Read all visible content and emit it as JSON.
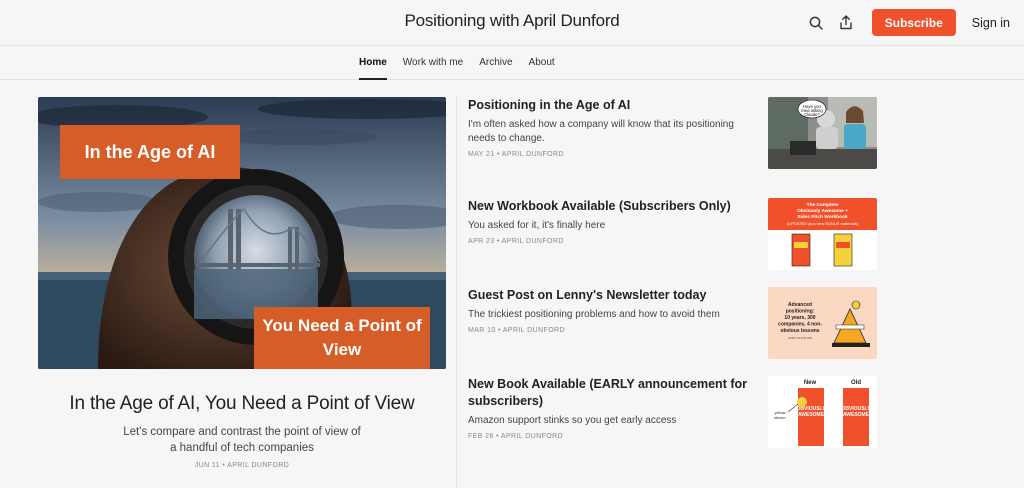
{
  "header": {
    "title": "Positioning with April Dunford",
    "subscribe_label": "Subscribe",
    "signin_label": "Sign in",
    "accent_color": "#f0512b"
  },
  "nav": {
    "tabs": [
      {
        "label": "Home",
        "active": true
      },
      {
        "label": "Work with me",
        "active": false
      },
      {
        "label": "Archive",
        "active": false
      },
      {
        "label": "About",
        "active": false
      }
    ]
  },
  "hero": {
    "image_text_top": "In the Age of AI",
    "image_text_bottom": "You Need a Point of View",
    "title": "In the Age of AI, You Need a Point of View",
    "subtitle": "Let's compare and contrast the point of view of a handful of tech companies",
    "meta": "JUN 11 • APRIL DUNFORD"
  },
  "posts": [
    {
      "title": "Positioning in the Age of AI",
      "subtitle": "I'm often asked how a company will know that its positioning needs to change.",
      "meta": "MAY 21 • APRIL DUNFORD",
      "thumb_text": "Have you tried asking Claude?"
    },
    {
      "title": "New Workbook Available (Subscribers Only)",
      "subtitle": "You asked for it, it's finally here",
      "meta": "APR 23 • APRIL DUNFORD",
      "thumb_text": "The Complete Obviously Awesome + Sales Pitch Workbook (UPDATED plus new BONUS materials)"
    },
    {
      "title": "Guest Post on Lenny's Newsletter today",
      "subtitle": "The trickiest positioning problems and how to avoid them",
      "meta": "MAR 10 • APRIL DUNFORD",
      "thumb_text": "Advanced positioning: 10 years, 300 companies, 4 non-obvious lessons",
      "thumb_caption": "APRIL DUNFORD"
    },
    {
      "title": "New Book Available (EARLY announcement for subscribers)",
      "subtitle": "Amazon support stinks so you get early access",
      "meta": "FEB 26 • APRIL DUNFORD",
      "thumb_new": "New",
      "thumb_old": "Old",
      "thumb_note": "yellow sticker"
    }
  ]
}
